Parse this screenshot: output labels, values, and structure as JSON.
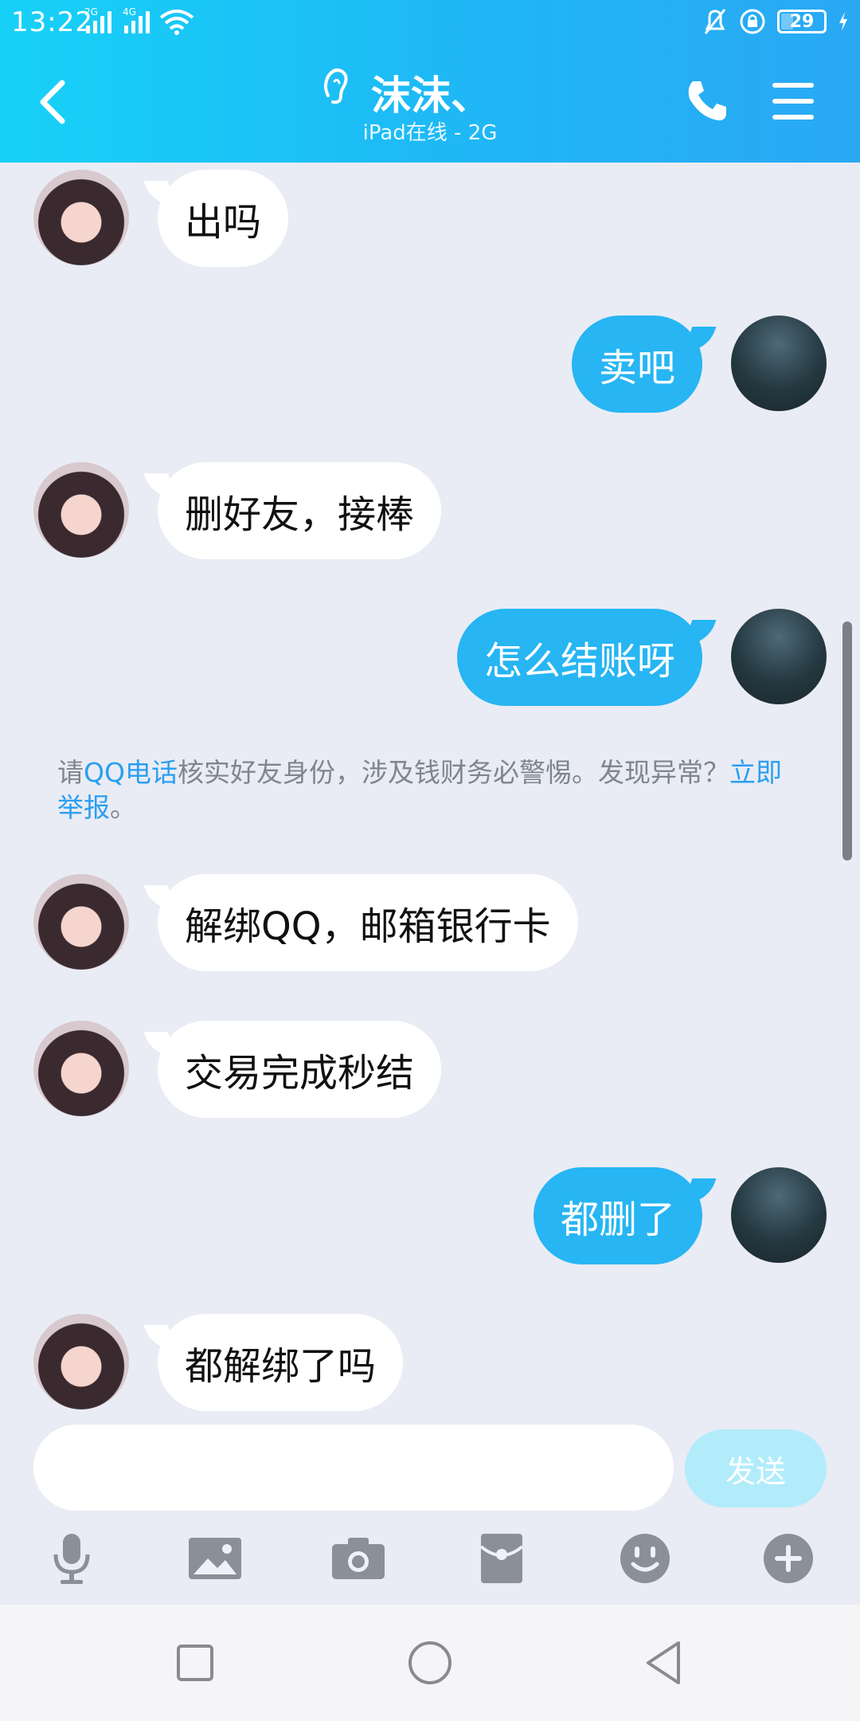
{
  "status_bar": {
    "time": "13:22",
    "sig1_label": "2G",
    "sig2_label": "4G",
    "battery": "29"
  },
  "header": {
    "title": "沫沫、",
    "subtitle": "iPad在线 - 2G"
  },
  "messages": [
    {
      "side": "in",
      "text": "出吗"
    },
    {
      "side": "out",
      "text": "卖吧"
    },
    {
      "side": "in",
      "text": "删好友，接棒"
    },
    {
      "side": "out",
      "text": "怎么结账呀"
    },
    {
      "side": "in",
      "text": "解绑QQ，邮箱银行卡"
    },
    {
      "side": "in",
      "text": "交易完成秒结"
    },
    {
      "side": "out",
      "text": "都删了"
    },
    {
      "side": "in",
      "text": "都解绑了吗"
    }
  ],
  "notice": {
    "prefix": "请",
    "link1": "QQ电话",
    "middle": "核实好友身份，涉及钱财务必警惕。发现异常？",
    "link2": "立即举报",
    "suffix": "。"
  },
  "input": {
    "placeholder": "",
    "send_label": "发送"
  },
  "toolbar": [
    "microphone-icon",
    "image-icon",
    "camera-icon",
    "red-packet-icon",
    "emoji-icon",
    "plus-icon"
  ],
  "colors": {
    "header": "#1fb7f5",
    "outgoing": "#27b5f3",
    "incoming": "#ffffff",
    "background": "#e9ecf4",
    "link": "#2a9ff0"
  }
}
